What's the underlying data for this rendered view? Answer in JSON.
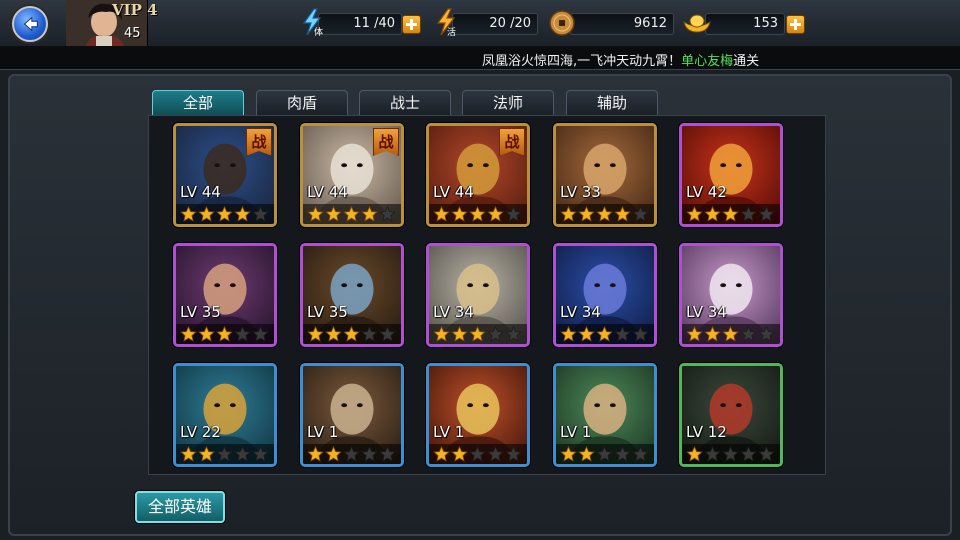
{
  "player": {
    "vip_label": "VIP 4",
    "level": "45"
  },
  "resources": {
    "stamina": {
      "value": "11 /40",
      "icon": "stamina-bolt-icon"
    },
    "vigor": {
      "value": "20 /20",
      "icon": "vigor-bolt-icon"
    },
    "coins": {
      "value": "9612",
      "icon": "copper-coin-icon"
    },
    "ingots": {
      "value": "153",
      "icon": "gold-ingot-icon"
    }
  },
  "marquee": {
    "before": "凤凰浴火惊四海,一飞冲天动九霄！",
    "highlight": "单心友梅",
    "after": "通关"
  },
  "tabs": [
    "全部",
    "肉盾",
    "战士",
    "法师",
    "辅助"
  ],
  "active_tab": "全部",
  "heroes": [
    {
      "level_text": "LV 44",
      "stars": 4,
      "max_stars": 5,
      "rarity": "orange",
      "deployed": true,
      "badge": "战"
    },
    {
      "level_text": "LV 44",
      "stars": 4,
      "max_stars": 5,
      "rarity": "orange",
      "deployed": true,
      "badge": "战"
    },
    {
      "level_text": "LV 44",
      "stars": 4,
      "max_stars": 5,
      "rarity": "orange",
      "deployed": true,
      "badge": "战"
    },
    {
      "level_text": "LV 33",
      "stars": 4,
      "max_stars": 5,
      "rarity": "orange",
      "deployed": false,
      "badge": ""
    },
    {
      "level_text": "LV 42",
      "stars": 3,
      "max_stars": 5,
      "rarity": "purple",
      "deployed": false,
      "badge": ""
    },
    {
      "level_text": "LV 35",
      "stars": 3,
      "max_stars": 5,
      "rarity": "purple",
      "deployed": false,
      "badge": ""
    },
    {
      "level_text": "LV 35",
      "stars": 3,
      "max_stars": 5,
      "rarity": "purple",
      "deployed": false,
      "badge": ""
    },
    {
      "level_text": "LV 34",
      "stars": 3,
      "max_stars": 5,
      "rarity": "purple",
      "deployed": false,
      "badge": ""
    },
    {
      "level_text": "LV 34",
      "stars": 3,
      "max_stars": 5,
      "rarity": "purple",
      "deployed": false,
      "badge": ""
    },
    {
      "level_text": "LV 34",
      "stars": 3,
      "max_stars": 5,
      "rarity": "purple",
      "deployed": false,
      "badge": ""
    },
    {
      "level_text": "LV 22",
      "stars": 2,
      "max_stars": 5,
      "rarity": "blue",
      "deployed": false,
      "badge": ""
    },
    {
      "level_text": "LV 1",
      "stars": 2,
      "max_stars": 5,
      "rarity": "blue",
      "deployed": false,
      "badge": ""
    },
    {
      "level_text": "LV 1",
      "stars": 2,
      "max_stars": 5,
      "rarity": "blue",
      "deployed": false,
      "badge": ""
    },
    {
      "level_text": "LV 1",
      "stars": 2,
      "max_stars": 5,
      "rarity": "blue",
      "deployed": false,
      "badge": ""
    },
    {
      "level_text": "LV 12",
      "stars": 1,
      "max_stars": 5,
      "rarity": "green",
      "deployed": false,
      "badge": ""
    }
  ],
  "all_heroes_button": "全部英雄",
  "colors": {
    "star_filled": "#f5b321",
    "star_empty": "#3a3a3a",
    "rarity_orange": "#b8903e",
    "rarity_purple": "#b04ed6",
    "rarity_blue": "#3c8fd2",
    "rarity_green": "#4fb85a",
    "tab_active": "#1f7d8a"
  }
}
